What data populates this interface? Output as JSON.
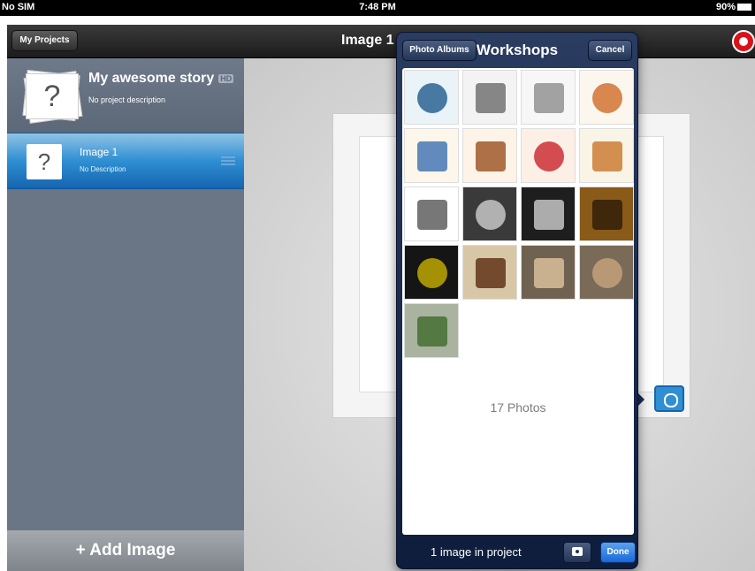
{
  "status_bar": {
    "carrier": "No SIM",
    "time": "7:48 PM",
    "battery": "90%"
  },
  "nav": {
    "back_label": "My Projects",
    "title": "Image 1"
  },
  "sidebar": {
    "project_title": "My awesome story",
    "hd_badge": "HD",
    "project_description": "No project description",
    "items": [
      {
        "title": "Image 1",
        "description": "No Description",
        "thumb_glyph": "?"
      }
    ],
    "add_label": "+ Add Image"
  },
  "popover": {
    "back_label": "Photo Albums",
    "title": "Workshops",
    "cancel_label": "Cancel",
    "photo_count": "17 Photos",
    "footer_text": "1 image in project",
    "done_label": "Done",
    "thumbnails": [
      {
        "name": "heron-drawing",
        "bg": "#e9f3f8",
        "fg": "#1f5a8c"
      },
      {
        "name": "wolf-drawing",
        "bg": "#f3f3f3",
        "fg": "#6a6a6a"
      },
      {
        "name": "cat-drawing",
        "bg": "#f7f7f7",
        "fg": "#8c8c8c"
      },
      {
        "name": "robin-drawing",
        "bg": "#fbf7ee",
        "fg": "#d06a25"
      },
      {
        "name": "boy-drawing",
        "bg": "#fdf6ea",
        "fg": "#3b6fb0"
      },
      {
        "name": "suit-figure",
        "bg": "#fdf3e6",
        "fg": "#9a4f1f"
      },
      {
        "name": "mountie-drawing",
        "bg": "#fcf0e6",
        "fg": "#c8242a"
      },
      {
        "name": "fox-cartoon",
        "bg": "#f9f4e6",
        "fg": "#c9752a"
      },
      {
        "name": "tree-sketch",
        "bg": "#ffffff",
        "fg": "#555555"
      },
      {
        "name": "lightning-photo",
        "bg": "#3a3a3a",
        "fg": "#cfcfcf"
      },
      {
        "name": "pointing-hand-photo",
        "bg": "#1e1e1e",
        "fg": "#d0d0d0"
      },
      {
        "name": "shadow-walk-photo",
        "bg": "#8a5a18",
        "fg": "#2b1a08"
      },
      {
        "name": "cat-eye-photo",
        "bg": "#151515",
        "fg": "#c8b000"
      },
      {
        "name": "walking-figure-photo",
        "bg": "#d7c7a7",
        "fg": "#5a2a10"
      },
      {
        "name": "boys-phone-photo",
        "bg": "#6f6250",
        "fg": "#e0c6a0"
      },
      {
        "name": "boys-back-photo",
        "bg": "#7a6a58",
        "fg": "#c9a57d"
      },
      {
        "name": "boy-tree-photo",
        "bg": "#a9b3a0",
        "fg": "#3f6a2a"
      }
    ]
  }
}
